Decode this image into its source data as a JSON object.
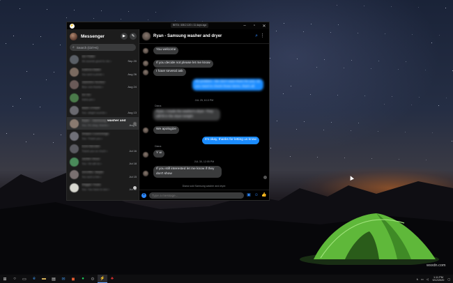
{
  "window": {
    "app_badge": "BETA: 408.2.120 • 11 days ago",
    "title": "Messenger",
    "search_placeholder": "Search (Ctrl+K)"
  },
  "conversations": [
    {
      "name_blur": "Ian Rabe",
      "name_clear": "",
      "snippet_blur": "Ok sounds good to me •",
      "time": "Sep 20",
      "color": "#5a5f66",
      "selected": false,
      "indicator": ""
    },
    {
      "name_blur": "Katrina Babe",
      "name_clear": "",
      "snippet_blur": "You sent a photo •",
      "time": "Aug 26",
      "color": "#7a6a60",
      "selected": false,
      "indicator": ""
    },
    {
      "name_blur": "Jasmine St.Dez",
      "name_clear": "",
      "snippet_blur": "Nice one thanks •",
      "time": "Aug 24",
      "color": "#6a5a58",
      "selected": false,
      "indicator": ""
    },
    {
      "name_blur": "So So",
      "name_clear": "",
      "snippet_blur": "Haha yes •",
      "time": "",
      "color": "#4a7a4a",
      "selected": false,
      "indicator": ""
    },
    {
      "name_blur": "Mark O'Neill",
      "name_clear": "",
      "snippet_blur": "You: alright sounds •",
      "time": "Aug 13",
      "color": "#6a6a70",
      "selected": false,
      "indicator": ""
    },
    {
      "name_blur": "Ryan - Samsung",
      "name_clear": " washer and",
      "snippet_blur": "You: It's okay, thanks •",
      "time": "Aug 6",
      "color": "#8a7a70",
      "selected": true,
      "indicator": "read"
    },
    {
      "name_blur": "Shawn Cummings",
      "name_clear": "",
      "snippet_blur": "You: Thank you •",
      "time": "",
      "color": "#707078",
      "selected": false,
      "indicator": ""
    },
    {
      "name_blur": "Kent Bender",
      "name_clear": "",
      "snippet_blur": "Thank you so much •",
      "time": "Jul 16",
      "color": "#5a5a60",
      "selected": false,
      "indicator": ""
    },
    {
      "name_blur": "Jackie Stout",
      "name_clear": "",
      "snippet_blur": "You: Ok will do •",
      "time": "Jul 18",
      "color": "#4a8a5a",
      "selected": false,
      "indicator": ""
    },
    {
      "name_blur": "Jennifer, Bayle",
      "name_clear": "",
      "snippet_blur": "You sent a link •",
      "time": "Jul 15",
      "color": "#7a7070",
      "selected": false,
      "indicator": ""
    },
    {
      "name_blur": "Wiggie Toast",
      "name_clear": "",
      "snippet_blur": "You: You have to see •",
      "time": "Jul 12",
      "color": "#d8d8d0",
      "selected": false,
      "indicator": "unread"
    }
  ],
  "chat": {
    "title": "Ryan - Samsung washer and dryer",
    "messages": {
      "m1": "You welcome",
      "m2": "If you decide not please let me know",
      "m3": "I have several ask",
      "m4": "No problem. We don't want them for you, so you need to check those items, that's all.",
      "stamp1": "JUL 25, 8:13 PM",
      "sender1": "Diana",
      "m5": "Ryan, I made the washer's dryer. They will fit in the dryer tonight",
      "m6": "We apologize",
      "m7": "It's okay, thanks for letting us know",
      "m8": "Y w",
      "stamp2": "JUL 30, 12:05 PM",
      "m9": "If you still interested let me know if they don't show",
      "footer_note": "Diana sold Samsung washer and dryer."
    },
    "composer_placeholder": "Type a message..."
  },
  "desktop": {
    "watermark": "wsxdn.com"
  },
  "taskbar": {
    "time": "1:11 PM",
    "date": "9/12/2020"
  }
}
